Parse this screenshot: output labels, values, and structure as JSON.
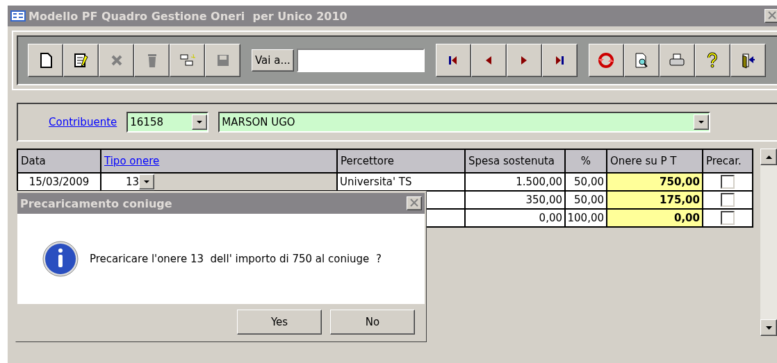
{
  "window": {
    "title": "Modello PF Quadro Gestione Oneri  per Unico 2010"
  },
  "toolbar": {
    "buttons": [
      {
        "kind": "new",
        "disabled": false
      },
      {
        "kind": "edit",
        "disabled": false
      },
      {
        "kind": "cut",
        "disabled": true
      },
      {
        "kind": "trash",
        "disabled": true
      },
      {
        "kind": "copy",
        "disabled": false
      },
      {
        "kind": "save",
        "disabled": true
      }
    ],
    "goto_button": "Vai a...",
    "nav_buttons": [
      {
        "kind": "first"
      },
      {
        "kind": "prev"
      },
      {
        "kind": "next"
      },
      {
        "kind": "last"
      }
    ],
    "tool_buttons": [
      {
        "kind": "refresh"
      },
      {
        "kind": "preview"
      },
      {
        "kind": "print"
      },
      {
        "kind": "help"
      },
      {
        "kind": "exit"
      }
    ]
  },
  "contribuente": {
    "label": "Contribuente",
    "code": "16158",
    "name": "MARSON UGO"
  },
  "table": {
    "columns": [
      "Data",
      "Tipo onere",
      "Percettore",
      "Spesa sostenuta",
      "%",
      "Onere su P T",
      "Precar."
    ],
    "rows": [
      {
        "data": "15/03/2009",
        "tipo_onere": "13",
        "percettore": "Universita' TS",
        "spesa": "1.500,00",
        "percent": "50,00",
        "onere": "750,00",
        "precar": false
      },
      {
        "spesa": "350,00",
        "percent": "50,00",
        "onere": "175,00",
        "precar": false
      },
      {
        "spesa": "0,00",
        "percent": "100,00",
        "onere": "0,00",
        "precar": false
      }
    ]
  },
  "dialog": {
    "title": "Precaricamento coniuge",
    "message": "Precaricare l'onere 13  dell' importo di 750 al coniuge  ?",
    "buttons": [
      "Yes",
      "No"
    ]
  }
}
